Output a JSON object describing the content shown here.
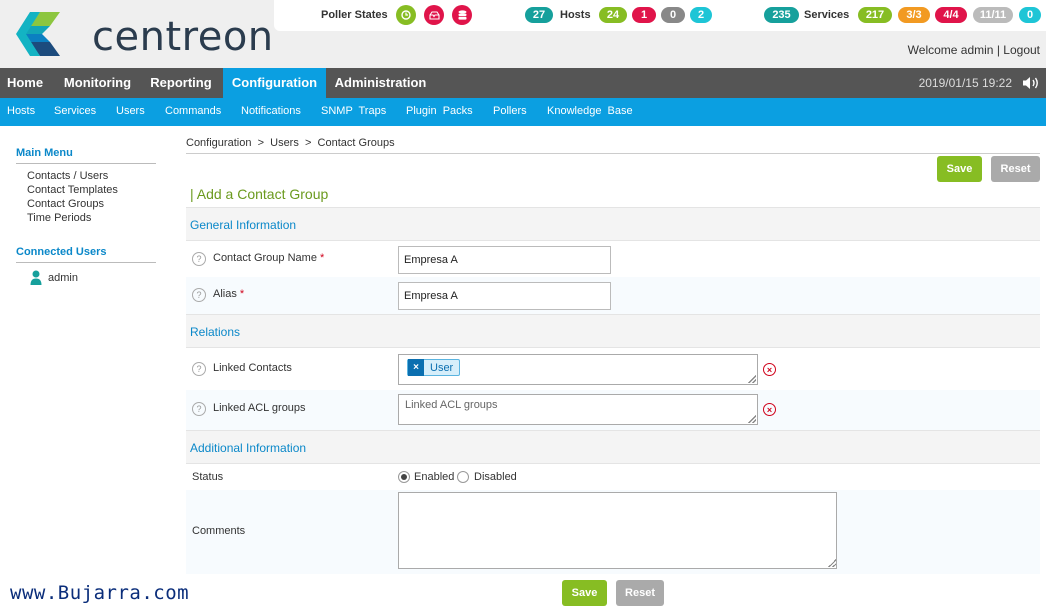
{
  "brand": {
    "name": "centreon",
    "colors": {
      "blue": "#0b9fe1",
      "green": "#87bd23",
      "red": "#e0144a",
      "orange": "#f29a22",
      "teal": "#16a09c",
      "cyan": "#1ec5d6",
      "grey": "#999999"
    }
  },
  "status_bar": {
    "poller_label": "Poller States",
    "poller_icons": [
      "clock-icon",
      "inbox-icon",
      "database-icon"
    ],
    "hosts_total": "27",
    "hosts_label": "Hosts",
    "hosts": [
      "24",
      "1",
      "0",
      "2"
    ],
    "services_total": "235",
    "services_label": "Services",
    "services": [
      "217",
      "3/3",
      "4/4",
      "11/11",
      "0"
    ]
  },
  "user": {
    "welcome": "Welcome admin",
    "separator": "|",
    "logout": "Logout"
  },
  "main_nav": {
    "items": [
      "Home",
      "Monitoring",
      "Reporting",
      "Configuration",
      "Administration"
    ],
    "active": "Configuration"
  },
  "datetime": "2019/01/15 19:22",
  "sub_nav": {
    "items": [
      "Hosts",
      "Services",
      "Users",
      "Commands",
      "Notifications",
      "SNMP  Traps",
      "Plugin  Packs",
      "Pollers",
      "Knowledge  Base"
    ]
  },
  "sidebar": {
    "main_menu_title": "Main Menu",
    "links": [
      "Contacts / Users",
      "Contact Templates",
      "Contact Groups",
      "Time Periods"
    ],
    "connected_title": "Connected Users",
    "connected_user": "admin"
  },
  "breadcrumb": [
    "Configuration",
    ">",
    "Users",
    ">",
    "Contact Groups"
  ],
  "buttons": {
    "save": "Save",
    "reset": "Reset"
  },
  "form": {
    "title": "| Add a Contact Group",
    "sections": {
      "general": "General Information",
      "relations": "Relations",
      "additional": "Additional Information"
    },
    "fields": {
      "name_label": "Contact Group Name",
      "name_value": "Empresa A",
      "alias_label": "Alias",
      "alias_value": "Empresa A",
      "required_mark": "*",
      "linked_contacts_label": "Linked Contacts",
      "linked_contacts_chip": "User",
      "chip_remove": "×",
      "linked_acl_label": "Linked ACL groups",
      "linked_acl_placeholder": "Linked ACL groups",
      "status_label": "Status",
      "status_enabled": "Enabled",
      "status_disabled": "Disabled",
      "status_value": "Enabled",
      "comments_label": "Comments",
      "comments_value": ""
    },
    "help_glyph": "?",
    "clear_glyph": "×"
  },
  "watermark": "www.Bujarra.com"
}
